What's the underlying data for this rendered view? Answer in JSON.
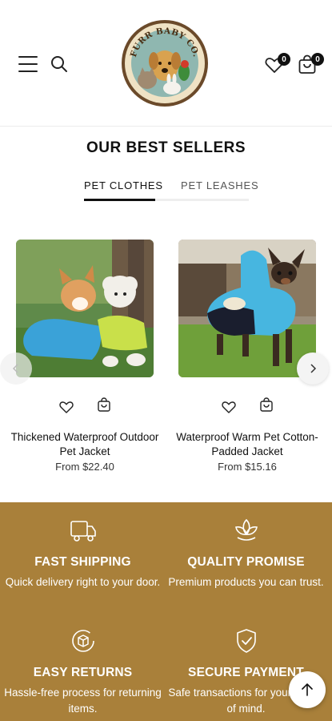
{
  "header": {
    "menu_icon": "hamburger-menu-icon",
    "search_icon": "search-icon",
    "logo_text": "FURR BABY CO.",
    "wishlist_count": "0",
    "cart_count": "0"
  },
  "section": {
    "title": "OUR BEST SELLERS",
    "tabs": [
      {
        "label": "PET CLOTHES",
        "active": true
      },
      {
        "label": "PET LEASHES",
        "active": false
      }
    ]
  },
  "products": [
    {
      "name": "Thickened Waterproof Outdoor Pet Jacket",
      "price": "From $22.40"
    },
    {
      "name": "Waterproof Warm Pet Cotton-Padded Jacket",
      "price": "From $15.16"
    }
  ],
  "features": [
    {
      "icon": "truck-icon",
      "title": "FAST SHIPPING",
      "desc": "Quick delivery right to your door."
    },
    {
      "icon": "leaf-icon",
      "title": "QUALITY PROMISE",
      "desc": "Premium products you can trust."
    },
    {
      "icon": "return-box-icon",
      "title": "EASY RETURNS",
      "desc": "Hassle-free process for returning items."
    },
    {
      "icon": "shield-check-icon",
      "title": "SECURE PAYMENT",
      "desc": "Safe transactions for your peace of mind."
    }
  ],
  "colors": {
    "feature_bg": "#a9803a",
    "accent_dark": "#111111"
  }
}
